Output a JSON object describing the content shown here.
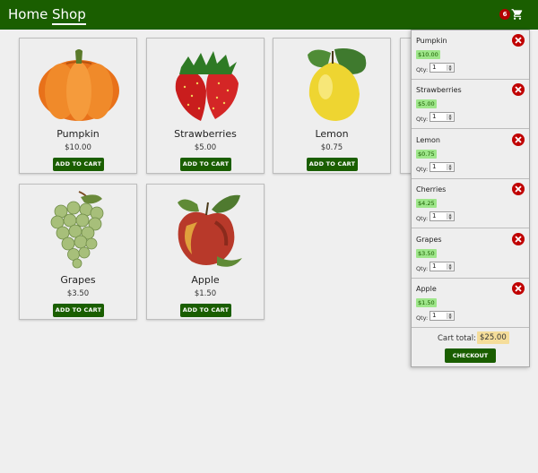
{
  "nav": {
    "home": "Home",
    "shop": "Shop"
  },
  "cart": {
    "count": "6"
  },
  "products": [
    {
      "name": "Pumpkin",
      "price": "$10.00",
      "button": "ADD TO CART"
    },
    {
      "name": "Strawberries",
      "price": "$5.00",
      "button": "ADD TO CART"
    },
    {
      "name": "Lemon",
      "price": "$0.75",
      "button": "ADD TO CART"
    },
    {
      "name": "Grapes",
      "price": "$3.50",
      "button": "ADD TO CART"
    },
    {
      "name": "Apple",
      "price": "$1.50",
      "button": "ADD TO CART"
    }
  ],
  "cart_panel": {
    "qty_label": "Qty:",
    "items": [
      {
        "name": "Pumpkin",
        "price": "$10.00",
        "qty": "1"
      },
      {
        "name": "Strawberries",
        "price": "$5.00",
        "qty": "1"
      },
      {
        "name": "Lemon",
        "price": "$0.75",
        "qty": "1"
      },
      {
        "name": "Cherries",
        "price": "$4.25",
        "qty": "1"
      },
      {
        "name": "Grapes",
        "price": "$3.50",
        "qty": "1"
      },
      {
        "name": "Apple",
        "price": "$1.50",
        "qty": "1"
      }
    ],
    "total_label": "Cart total:",
    "total_value": "$25.00",
    "checkout": "CHECKOUT"
  },
  "colors": {
    "header": "#1a5e00",
    "button": "#1a5e00",
    "remove": "#c00000",
    "price_badge": "#9ee68a",
    "total_badge": "#f5dd9a"
  }
}
